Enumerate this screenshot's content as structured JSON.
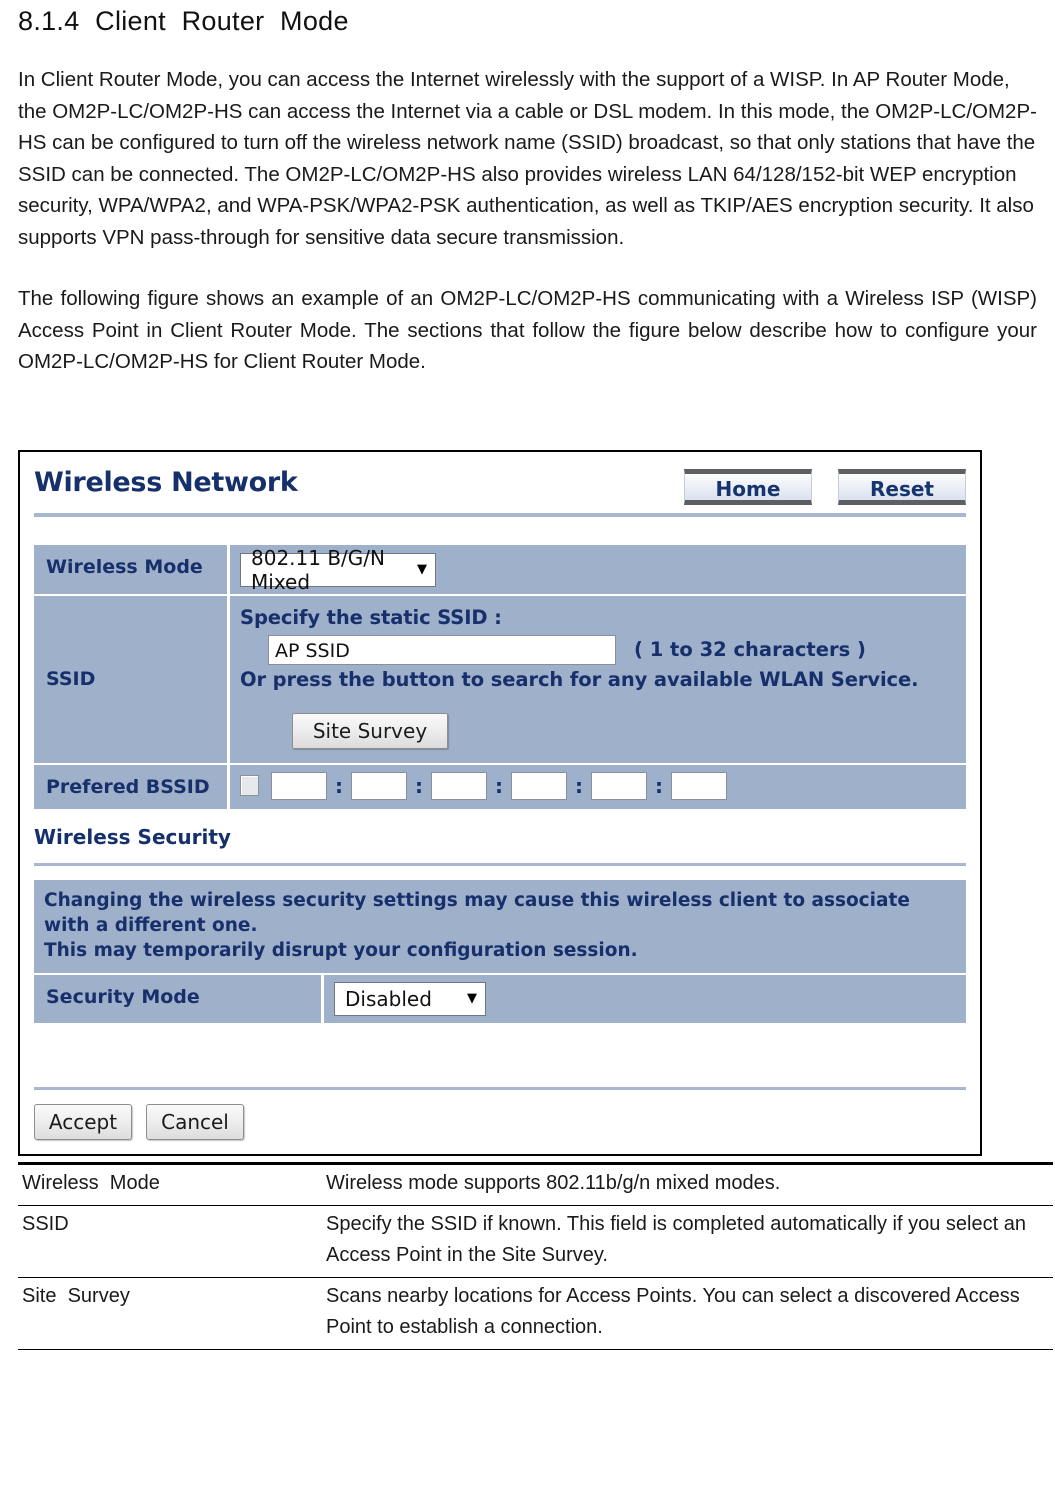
{
  "document": {
    "heading": "8.1.4  Client  Router  Mode",
    "paragraph_1": "In Client Router Mode, you can access the Internet wirelessly with the support of a WISP. In AP Router Mode, the OM2P-LC/OM2P-HS can access the Internet via a cable or DSL modem. In this mode, the OM2P-LC/OM2P-HS can be configured to turn off the wireless network name (SSID) broadcast, so that only stations that have the SSID can be connected. The OM2P-LC/OM2P-HS also provides wireless LAN\n64/128/152-bit WEP encryption security, WPA/WPA2, and WPA-PSK/WPA2-PSK authentication, as well as TKIP/AES encryption security. It also supports VPN pass-through for sensitive data secure transmission.",
    "paragraph_2": "The following figure shows an example of an OM2P-LC/OM2P-HS communicating with a Wireless ISP (WISP) Access Point in Client Router Mode. The sections that follow the figure below describe how to configure your OM2P-LC/OM2P-HS for Client Router Mode."
  },
  "screenshot": {
    "title": "Wireless Network",
    "header_buttons": [
      {
        "label": "Home",
        "name": "home-button"
      },
      {
        "label": "Reset",
        "name": "reset-button"
      }
    ],
    "wireless_mode": {
      "label": "Wireless Mode",
      "value": "802.11 B/G/N Mixed",
      "options": [
        "802.11 B/G/N Mixed"
      ]
    },
    "ssid": {
      "label": "SSID",
      "prompt": "Specify the static SSID  :",
      "value": "AP SSID",
      "hint": "( 1 to 32 characters )",
      "note": "Or press the button to search for any available WLAN Service.",
      "site_survey_label": "Site Survey"
    },
    "prefered_bssid": {
      "label": "Prefered BSSID",
      "checked": false,
      "octets": [
        "",
        "",
        "",
        "",
        "",
        ""
      ],
      "separator": ":"
    },
    "wireless_security": {
      "heading": "Wireless Security",
      "notice_line_1": "Changing the wireless security settings may cause this wireless client to associate with a different one.",
      "notice_line_2": "This may temporarily disrupt your configuration session.",
      "security_mode": {
        "label": "Security Mode",
        "value": "Disabled",
        "options": [
          "Disabled"
        ]
      }
    },
    "footer_buttons": [
      {
        "label": "Accept",
        "name": "accept-button"
      },
      {
        "label": "Cancel",
        "name": "cancel-button"
      }
    ],
    "colors": {
      "row_background": "#9fb0ca",
      "title_text": "#15306b",
      "rule": "#a9b6cf"
    }
  },
  "description_table": {
    "rows": [
      {
        "term": "Wireless  Mode",
        "definition": "Wireless mode supports 802.11b/g/n mixed modes."
      },
      {
        "term": "SSID",
        "definition": "Specify the SSID if known. This field is completed automatically if you select an Access Point in the Site Survey."
      },
      {
        "term": "Site  Survey",
        "definition": "Scans nearby locations for Access Points. You can select a discovered Access Point to establish a connection."
      }
    ]
  }
}
